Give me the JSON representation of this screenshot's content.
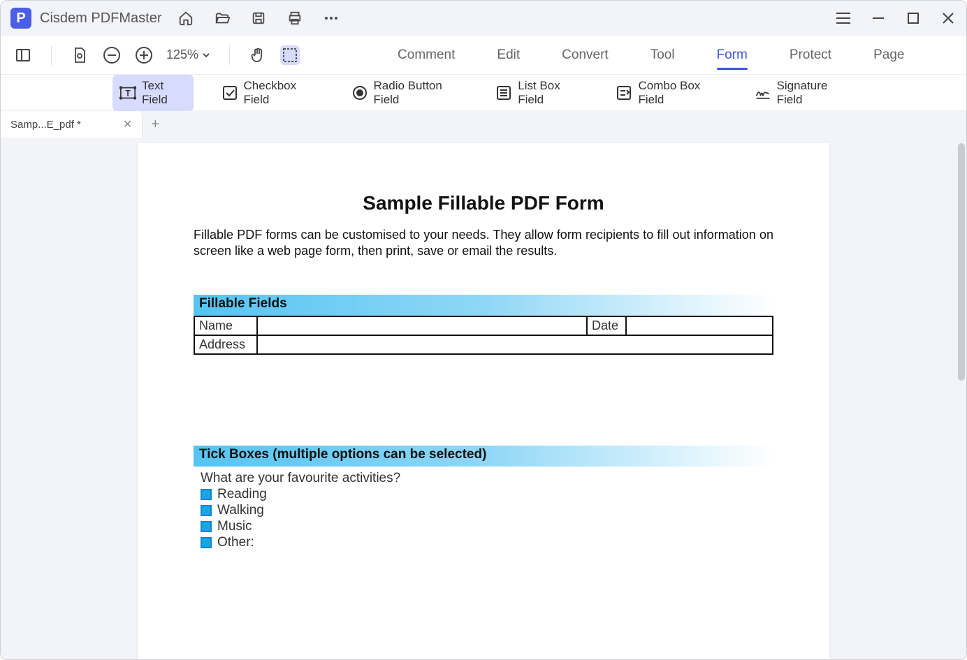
{
  "app": {
    "title": "Cisdem PDFMaster",
    "logo_letter": "P"
  },
  "toolbar": {
    "zoom_level": "125%",
    "tabs": {
      "comment": "Comment",
      "edit": "Edit",
      "convert": "Convert",
      "tool": "Tool",
      "form": "Form",
      "protect": "Protect",
      "page": "Page"
    }
  },
  "form_tools": {
    "text_field": "Text Field",
    "checkbox_field": "Checkbox Field",
    "radio_button_field": "Radio Button Field",
    "list_box_field": "List Box Field",
    "combo_box_field": "Combo Box Field",
    "signature_field": "Signature Field"
  },
  "tab": {
    "name": "Samp...E_pdf *"
  },
  "document": {
    "title": "Sample Fillable PDF Form",
    "intro": "Fillable PDF forms can be customised to your needs. They allow form recipients to fill out information on screen like a web page form, then print, save or email the results.",
    "section1_title": "Fillable Fields",
    "labels": {
      "name": "Name",
      "date": "Date",
      "address": "Address"
    },
    "section2_title": "Tick Boxes (multiple options can be selected)",
    "question": "What are your favourite activities?",
    "options": [
      "Reading",
      "Walking",
      "Music",
      "Other:"
    ]
  }
}
